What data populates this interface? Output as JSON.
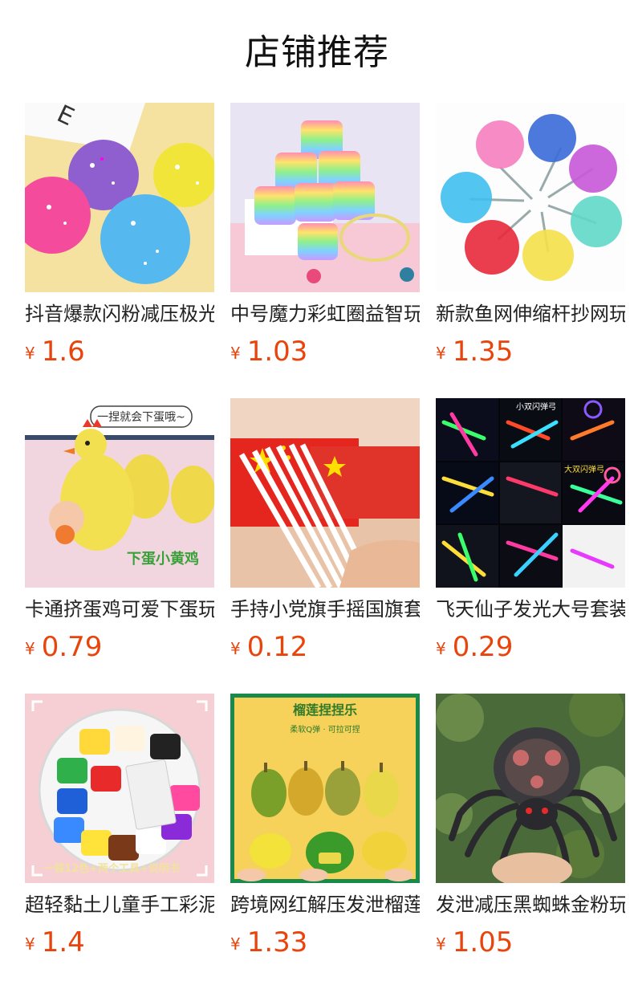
{
  "section_title": "店铺推荐",
  "accent_color": "#e8440c",
  "currency_symbol": "¥",
  "products": [
    {
      "name": "抖音爆款闪粉减压极光球",
      "price": "1.6"
    },
    {
      "name": "中号魔力彩虹圈益智玩具",
      "price": "1.03"
    },
    {
      "name": "新款鱼网伸缩杆抄网玩具",
      "price": "1.35"
    },
    {
      "name": "卡通挤蛋鸡可爱下蛋玩具",
      "price": "0.79",
      "image_caption": "一捏就会下蛋哦~",
      "image_tag": "下蛋小黄鸡"
    },
    {
      "name": "手持小党旗手摇国旗套装",
      "price": "0.12"
    },
    {
      "name": "飞天仙子发光大号套装",
      "price": "0.29",
      "image_caption_1": "小双闪弹弓",
      "image_caption_2": "大双闪弹弓"
    },
    {
      "name": "超轻黏土儿童手工彩泥",
      "price": "1.4",
      "image_tag": "一袋12色+两个工具+说明书"
    },
    {
      "name": "跨境网红解压发泄榴莲球",
      "price": "1.33",
      "image_title": "榴莲捏捏乐",
      "image_subtitle": "柔软Q弹 · 可拉可捏"
    },
    {
      "name": "发泄减压黑蜘蛛金粉玩具",
      "price": "1.05"
    }
  ]
}
